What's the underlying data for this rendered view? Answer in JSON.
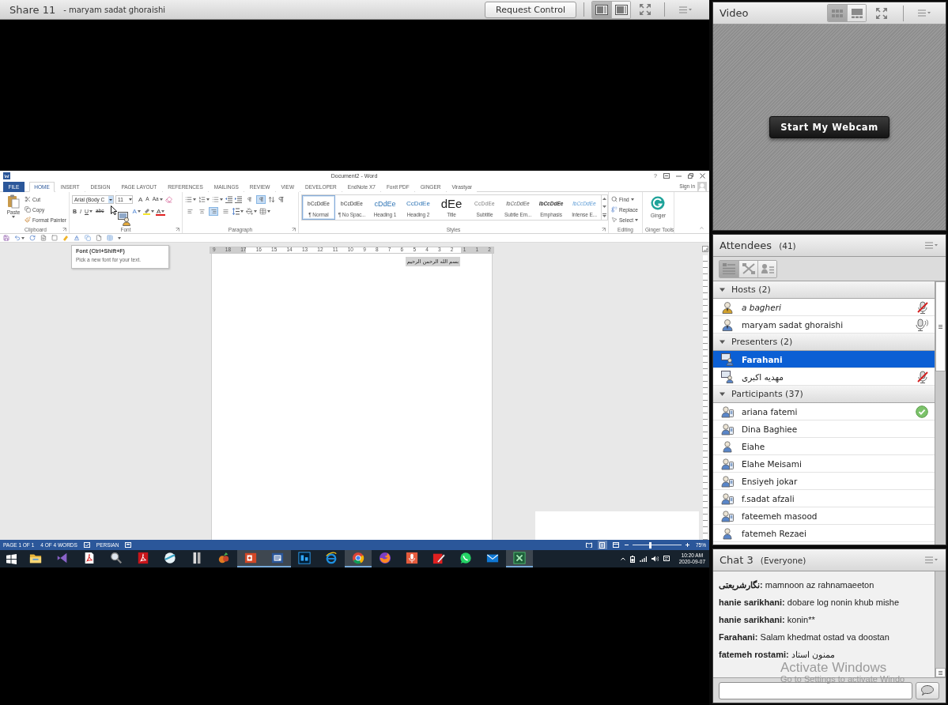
{
  "share_pod": {
    "title": "Share 11",
    "presenter": "- maryam sadat ghoraishi",
    "request_control": "Request Control",
    "layout_toggles": [
      {
        "selected": true
      },
      {
        "selected": false
      }
    ]
  },
  "word": {
    "title": "Document2 - Word",
    "help": "?",
    "tabs": [
      {
        "label": "FILE",
        "kind": "backstage",
        "selected": false
      },
      {
        "label": "HOME",
        "kind": "tab",
        "selected": true
      },
      {
        "label": "INSERT",
        "kind": "tab",
        "selected": false
      },
      {
        "label": "DESIGN",
        "kind": "tab",
        "selected": false
      },
      {
        "label": "PAGE LAYOUT",
        "kind": "tab",
        "selected": false
      },
      {
        "label": "REFERENCES",
        "kind": "tab",
        "selected": false
      },
      {
        "label": "MAILINGS",
        "kind": "tab",
        "selected": false
      },
      {
        "label": "REVIEW",
        "kind": "tab",
        "selected": false
      },
      {
        "label": "VIEW",
        "kind": "tab",
        "selected": false
      },
      {
        "label": "DEVELOPER",
        "kind": "tab",
        "selected": false
      },
      {
        "label": "EndNote X7",
        "kind": "tab",
        "selected": false
      },
      {
        "label": "Foxit PDF",
        "kind": "tab",
        "selected": false
      },
      {
        "label": "GINGER",
        "kind": "tab",
        "selected": false
      },
      {
        "label": "Virastyar",
        "kind": "tab",
        "selected": false
      }
    ],
    "sign_in": "Sign in",
    "clipboard": {
      "label": "Clipboard",
      "paste": "Paste",
      "actions": [
        "Cut",
        "Copy",
        "Format Painter"
      ]
    },
    "font": {
      "label": "Font",
      "name": "Arial (Body C",
      "size": "11",
      "size_buttons": [
        "A",
        "A",
        "Aa"
      ],
      "format_buttons": [
        "B",
        "I",
        "U",
        "abc"
      ],
      "color_buttons": [
        "A",
        "A"
      ]
    },
    "paragraph": {
      "label": "Paragraph",
      "directions": [
        {
          "selected": false
        },
        {
          "selected": true
        }
      ],
      "alignments": [
        {
          "selected": false
        },
        {
          "selected": false
        },
        {
          "selected": true
        },
        {
          "selected": false
        }
      ]
    },
    "styles": {
      "label": "Styles",
      "items": [
        {
          "kind": "normal",
          "preview": "bCcDdEe",
          "name": "¶ Normal",
          "selected": true
        },
        {
          "kind": "normal",
          "preview": "bCcDdEe",
          "name": "¶ No Spac...",
          "selected": false
        },
        {
          "kind": "heading1",
          "preview": "cDdEe",
          "name": "Heading 1",
          "selected": false
        },
        {
          "kind": "heading2",
          "preview": "CcDdEe",
          "name": "Heading 2",
          "selected": false
        },
        {
          "kind": "title",
          "preview": "dEe",
          "name": "Title",
          "selected": false
        },
        {
          "kind": "subtitle",
          "preview": "CcDdEe",
          "name": "Subtitle",
          "selected": false
        },
        {
          "kind": "subtle",
          "preview": "lbCcDdEe",
          "name": "Subtle Em...",
          "selected": false
        },
        {
          "kind": "emphasis",
          "preview": "lbCcDdEe",
          "name": "Emphasis",
          "selected": false
        },
        {
          "kind": "intense",
          "preview": "lbCcDdEe",
          "name": "Intense E...",
          "selected": false
        }
      ]
    },
    "editing": {
      "label": "Editing",
      "actions": [
        "Find",
        "Replace",
        "Select"
      ]
    },
    "ginger": {
      "label": "Ginger Tools",
      "button": "Ginger"
    },
    "tooltip": {
      "title": "Font (Ctrl+Shift+F)",
      "text": "Pick a new font for your text."
    },
    "ruler": [
      "9",
      "18",
      "17",
      "16",
      "15",
      "14",
      "13",
      "12",
      "11",
      "10",
      "9",
      "8",
      "7",
      "6",
      "5",
      "4",
      "3",
      "2",
      "1",
      "1",
      "2"
    ],
    "page_text": "بسم الله الرحمن الرحيم",
    "status_bar": {
      "page": "PAGE 1 OF 1",
      "words": "4 OF 4 WORDS",
      "language": "PERSIAN",
      "views": [
        {
          "selected": false
        },
        {
          "selected": true
        },
        {
          "selected": false
        }
      ],
      "zoom_slider": {
        "level": 0.37
      },
      "zoom": "75%"
    }
  },
  "taskbar": {
    "apps": [
      {
        "kind": "explorer",
        "active": false
      },
      {
        "kind": "vstudio",
        "active": false
      },
      {
        "kind": "acrobat",
        "active": false
      },
      {
        "kind": "tool",
        "active": false
      },
      {
        "kind": "acrobat_dc",
        "active": false
      },
      {
        "kind": "sphere",
        "active": false
      },
      {
        "kind": "archive",
        "active": false
      },
      {
        "kind": "fruit",
        "active": false
      },
      {
        "kind": "powerpoint",
        "active": true
      },
      {
        "kind": "word",
        "active": true
      },
      {
        "kind": "photoshop",
        "active": false
      },
      {
        "kind": "ie",
        "active": false
      },
      {
        "kind": "chrome",
        "active": true
      },
      {
        "kind": "firefox",
        "active": false
      },
      {
        "kind": "recorder",
        "active": false
      },
      {
        "kind": "pdf_editor",
        "active": false
      },
      {
        "kind": "whatsapp",
        "active": false
      },
      {
        "kind": "outlook",
        "active": false
      },
      {
        "kind": "terminal",
        "active": true
      }
    ],
    "time": "10:20 AM",
    "date": "2020-09-07"
  },
  "video_pod": {
    "title": "Video",
    "layout_toggles": [
      {
        "selected": true
      },
      {
        "selected": false
      }
    ],
    "webcam_button": "Start My Webcam"
  },
  "attendees_pod": {
    "title": "Attendees",
    "count": "(41)",
    "views": [
      {
        "selected": true
      },
      {
        "selected": false
      },
      {
        "selected": false
      }
    ],
    "groups": [
      {
        "label": "Hosts (2)",
        "expanded": true,
        "members": [
          {
            "name": "a bagheri",
            "kind": "host",
            "current_user": true,
            "selected": false,
            "status": {
              "kind": "mic_muted"
            }
          },
          {
            "name": "maryam sadat ghoraishi",
            "kind": "host",
            "current_user": false,
            "selected": false,
            "status": {
              "kind": "mic_on"
            }
          }
        ]
      },
      {
        "label": "Presenters (2)",
        "expanded": true,
        "members": [
          {
            "name": "Farahani",
            "kind": "presenter",
            "current_user": false,
            "selected": true
          },
          {
            "name": "مهدیه اکبری",
            "kind": "presenter",
            "current_user": false,
            "selected": false,
            "status": {
              "kind": "mic_muted"
            }
          }
        ]
      },
      {
        "label": "Participants (37)",
        "expanded": true,
        "members": [
          {
            "name": "ariana fatemi",
            "kind": "device_participant",
            "current_user": false,
            "selected": false,
            "status": {
              "kind": "agree"
            }
          },
          {
            "name": "Dina Baghiee",
            "kind": "device_participant",
            "current_user": false,
            "selected": false
          },
          {
            "name": "Eiahe",
            "kind": "participant",
            "current_user": false,
            "selected": false
          },
          {
            "name": "Elahe Meisami",
            "kind": "device_participant",
            "current_user": false,
            "selected": false
          },
          {
            "name": "Ensiyeh jokar",
            "kind": "device_participant",
            "current_user": false,
            "selected": false
          },
          {
            "name": "f.sadat afzali",
            "kind": "device_participant",
            "current_user": false,
            "selected": false
          },
          {
            "name": "fateemeh masood",
            "kind": "device_participant",
            "current_user": false,
            "selected": false
          },
          {
            "name": "fatemeh Rezaei",
            "kind": "participant",
            "current_user": false,
            "selected": false
          }
        ]
      }
    ]
  },
  "chat_pod": {
    "title": "Chat 3",
    "audience": "(Everyone)",
    "messages": [
      {
        "sender": "نگارشریعتی:",
        "text": "mamnoon az rahnamaeeton"
      },
      {
        "sender": "hanie sarikhani:",
        "text": "dobare log nonin khub mishe"
      },
      {
        "sender": "hanie sarikhani:",
        "text": "konin**"
      },
      {
        "sender": "Farahani:",
        "text": "Salam khedmat ostad va doostan"
      },
      {
        "sender": "fatemeh rostami:",
        "text": "ممنون استاد"
      }
    ]
  },
  "activation_notice": {
    "title": "Activate Windows",
    "text": "Go to Settings to activate Windo"
  }
}
